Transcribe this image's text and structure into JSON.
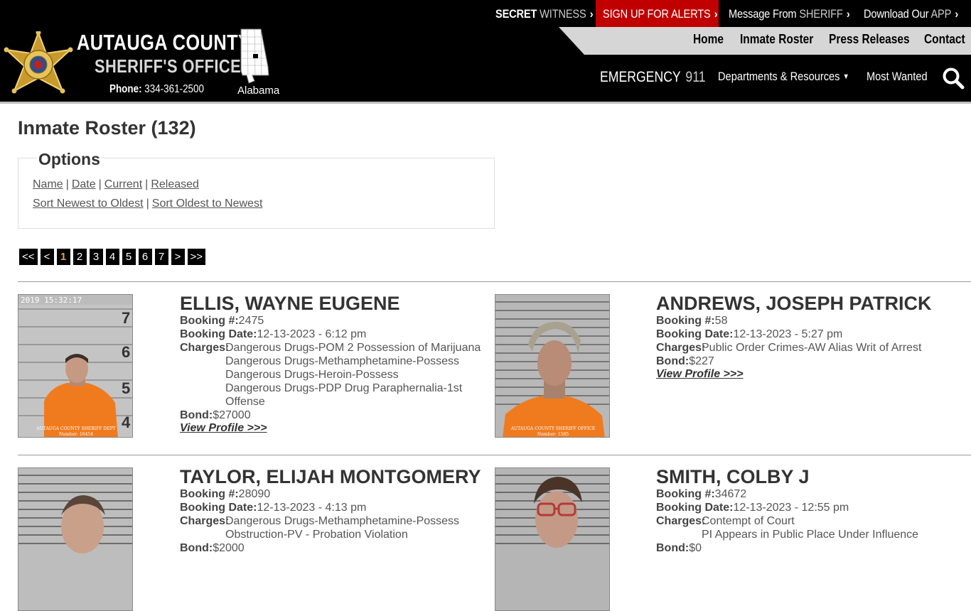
{
  "topbar": {
    "secret_witness": {
      "a": "SECRET",
      "b": "WITNESS"
    },
    "alerts": {
      "a": "SIGN UP FOR ALERTS",
      "b": ""
    },
    "message": {
      "a": "Message From",
      "b": "SHERIFF"
    },
    "app": {
      "a": "Download Our",
      "b": "APP"
    },
    "alert_color": "#c00000"
  },
  "header": {
    "org_line1": "AUTAUGA COUNTY",
    "org_line2": "SHERIFF'S OFFICE",
    "phone_label": "Phone:",
    "phone_number": "334-361-2500",
    "state": "Alabama",
    "badge_icon": "sheriff-star-badge",
    "map_icon": "alabama-county-map"
  },
  "nav": {
    "home": "Home",
    "roster": "Inmate Roster",
    "press": "Press Releases",
    "contact": "Contact"
  },
  "emergency": {
    "label": "EMERGENCY",
    "number": "911"
  },
  "subnav": {
    "departments": "Departments & Resources",
    "departments_icon": "chevron-down-icon",
    "wanted": "Most Wanted",
    "search_icon": "search-icon"
  },
  "page": {
    "title": "Inmate Roster (132)"
  },
  "options": {
    "legend": "Options",
    "filters": [
      "Name",
      "Date",
      "Current",
      "Released"
    ],
    "sorts": [
      "Sort Newest to Oldest",
      "Sort Oldest to Newest"
    ],
    "separator": "|"
  },
  "pager": {
    "first": "<<",
    "prev": "<",
    "pages": [
      "1",
      "2",
      "3",
      "4",
      "5",
      "6",
      "7"
    ],
    "current": "1",
    "next": ">",
    "last": ">>"
  },
  "labels": {
    "booking_no": "Booking #:",
    "booking_date": "Booking Date:",
    "charges": "Charges:",
    "bond": "Bond:",
    "view_profile": "View Profile >>>"
  },
  "inmates": [
    {
      "name": "ELLIS, WAYNE EUGENE",
      "booking_no": "2475",
      "booking_date": "12-13-2023 - 6:12 pm",
      "charges": [
        "Dangerous Drugs-POM 2 Possession of Marijuana",
        "Dangerous Drugs-Methamphetamine-Possess",
        "Dangerous Drugs-Heroin-Possess",
        "Dangerous Drugs-PDP Drug Paraphernalia-1st Offense"
      ],
      "bond": "$27000",
      "photo_caption": "AUTAUGA COUNTY SHERIFF DEPT",
      "photo_number": "Number: 16454",
      "photo_stamp": "2019 15:32:17",
      "height_marks": [
        "7",
        "6",
        "5",
        "4"
      ],
      "shirt_color": "#f07b1e"
    },
    {
      "name": "ANDREWS, JOSEPH PATRICK",
      "booking_no": "58",
      "booking_date": "12-13-2023 - 5:27 pm",
      "charges": [
        "Public Order Crimes-AW Alias Writ of Arrest"
      ],
      "bond": "$227",
      "photo_caption": "AUTAUGA COUNTY SHERIFF OFFICE",
      "photo_number": "Number: 1585",
      "shirt_color": "#f07b1e"
    },
    {
      "name": "TAYLOR, ELIJAH MONTGOMERY",
      "booking_no": "28090",
      "booking_date": "12-13-2023 - 4:13 pm",
      "charges": [
        "Dangerous Drugs-Methamphetamine-Possess",
        "Obstruction-PV - Probation Violation"
      ],
      "bond": "$2000"
    },
    {
      "name": "SMITH, COLBY J",
      "booking_no": "34672",
      "booking_date": "12-13-2023 - 12:55 pm",
      "charges": [
        "Contempt of Court",
        "PI Appears in Public Place Under Influence"
      ],
      "bond": "$0"
    }
  ]
}
